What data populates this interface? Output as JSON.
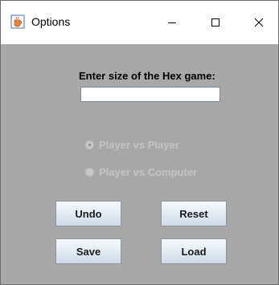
{
  "window": {
    "title": "Options",
    "icon": "java-cup-icon",
    "controls": [
      "minimize-icon",
      "maximize-icon",
      "close-icon"
    ]
  },
  "form": {
    "prompt": "Enter size of the Hex game:",
    "size_value": "",
    "modes": [
      {
        "label": "Player vs Player",
        "selected": true,
        "enabled": false
      },
      {
        "label": "Player vs Computer",
        "selected": false,
        "enabled": false
      }
    ]
  },
  "buttons": {
    "undo": "Undo",
    "reset": "Reset",
    "save": "Save",
    "load": "Load"
  },
  "colors": {
    "panel_bg": "#a8a8a8",
    "disabled_text": "#c3c3c3"
  }
}
